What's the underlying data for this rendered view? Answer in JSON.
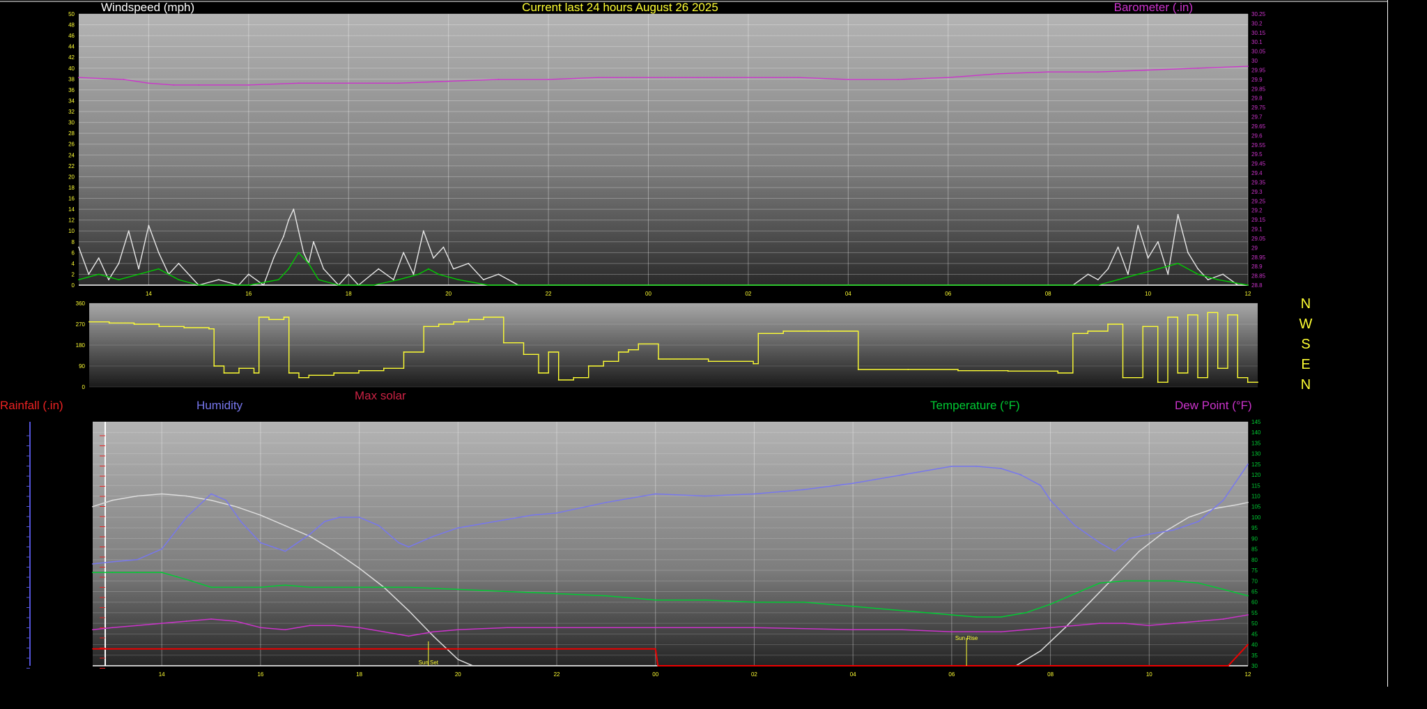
{
  "header": {
    "windspeed_title": "Windspeed (mph)",
    "main_title": "Current last 24 hours August 26 2025",
    "barometer_title": "Barometer (.in)"
  },
  "compass": {
    "labels": [
      "N",
      "W",
      "S",
      "E",
      "N"
    ]
  },
  "bottom_legend": {
    "rainfall": "Rainfall (.in)",
    "humidity": "Humidity",
    "max_solar": "Max solar",
    "temperature": "Temperature (°F)",
    "dew_point": "Dew Point (°F)"
  },
  "annotations": {
    "sunset": "Sun Set",
    "sunrise": "Sun Rise"
  },
  "colors": {
    "wind": "#e8e8e8",
    "gust": "#00cc00",
    "barometer": "#cc33cc",
    "direction": "#ffff33",
    "humidity": "#7777ee",
    "temperature": "#00cc33",
    "dewpoint": "#cc33cc",
    "rain": "#ee0000",
    "solar": "#dddddd",
    "title": "#ffff33",
    "rain_label": "#ee2222",
    "solar_label": "#cc2244"
  },
  "chart_data": [
    {
      "type": "line",
      "name": "windspeed-barometer",
      "x_ticks": [
        "14",
        "16",
        "18",
        "20",
        "22",
        "00",
        "02",
        "04",
        "06",
        "08",
        "10",
        "12"
      ],
      "x_hours": [
        14,
        16,
        18,
        20,
        22,
        24,
        26,
        28,
        30,
        32,
        34,
        36
      ],
      "xlim": [
        12.6,
        36
      ],
      "ylabel_left": "Windspeed (mph)",
      "ylim_left": [
        0,
        50
      ],
      "yticks_left": [
        "0",
        "2",
        "4",
        "6",
        "8",
        "10",
        "12",
        "14",
        "16",
        "18",
        "20",
        "22",
        "24",
        "26",
        "28",
        "30",
        "32",
        "34",
        "36",
        "38",
        "40",
        "42",
        "44",
        "46",
        "48",
        "50"
      ],
      "ylabel_right": "Barometer (.in)",
      "ylim_right": [
        28.8,
        30.25
      ],
      "yticks_right": [
        "28.8",
        "28.85",
        "28.9",
        "28.95",
        "29",
        "29.05",
        "29.1",
        "29.15",
        "29.2",
        "29.25",
        "29.3",
        "29.35",
        "29.4",
        "29.45",
        "29.5",
        "29.55",
        "29.6",
        "29.65",
        "29.7",
        "29.75",
        "29.8",
        "29.85",
        "29.9",
        "29.95",
        "30",
        "30.05",
        "30.1",
        "30.15",
        "30.2",
        "30.25"
      ],
      "series": [
        {
          "key": "wind",
          "x": [
            12.6,
            12.8,
            13.0,
            13.2,
            13.4,
            13.6,
            13.8,
            14.0,
            14.2,
            14.4,
            14.6,
            15.0,
            15.4,
            15.8,
            16.0,
            16.3,
            16.5,
            16.7,
            16.8,
            16.9,
            17.0,
            17.1,
            17.2,
            17.3,
            17.5,
            17.8,
            18.0,
            18.2,
            18.6,
            18.9,
            19.1,
            19.3,
            19.5,
            19.7,
            19.9,
            20.1,
            20.4,
            20.7,
            21.0,
            21.4,
            22.0,
            24.0,
            28.0,
            32.0,
            32.5,
            32.8,
            33.0,
            33.2,
            33.4,
            33.6,
            33.8,
            34.0,
            34.2,
            34.4,
            34.6,
            34.8,
            35.0,
            35.2,
            35.5,
            35.8,
            36.0
          ],
          "y": [
            7,
            2,
            5,
            1,
            4,
            10,
            3,
            11,
            6,
            2,
            4,
            0,
            1,
            0,
            2,
            0,
            5,
            9,
            12,
            14,
            10,
            6,
            4,
            8,
            3,
            0,
            2,
            0,
            3,
            1,
            6,
            2,
            10,
            5,
            7,
            3,
            4,
            1,
            2,
            0,
            0,
            0,
            0,
            0,
            0,
            2,
            1,
            3,
            7,
            2,
            11,
            5,
            8,
            2,
            13,
            6,
            3,
            1,
            2,
            0,
            0
          ]
        },
        {
          "key": "gust",
          "x": [
            12.6,
            13.0,
            13.4,
            13.8,
            14.2,
            14.6,
            15.0,
            16.0,
            16.6,
            16.8,
            17.0,
            17.2,
            17.4,
            17.8,
            18.5,
            19.0,
            19.4,
            19.6,
            19.8,
            20.2,
            20.8,
            22.0,
            28.0,
            33.0,
            33.4,
            33.8,
            34.2,
            34.6,
            35.0,
            35.4,
            36.0
          ],
          "y": [
            1,
            2,
            1,
            2,
            3,
            1,
            0,
            0,
            1,
            3,
            6,
            4,
            1,
            0,
            0,
            1,
            2,
            3,
            2,
            1,
            0,
            0,
            0,
            0,
            1,
            2,
            3,
            4,
            2,
            1,
            0
          ]
        },
        {
          "key": "barometer",
          "x": [
            12.6,
            13.5,
            14.0,
            14.5,
            15.0,
            16.0,
            17.0,
            18.0,
            19.0,
            20.0,
            21.0,
            22.0,
            23.0,
            24.0,
            25.0,
            26.0,
            27.0,
            28.0,
            29.0,
            30.0,
            31.0,
            32.0,
            33.0,
            34.0,
            35.0,
            36.0
          ],
          "y": [
            29.91,
            29.9,
            29.88,
            29.87,
            29.87,
            29.87,
            29.88,
            29.88,
            29.88,
            29.89,
            29.9,
            29.9,
            29.91,
            29.91,
            29.91,
            29.91,
            29.91,
            29.9,
            29.9,
            29.91,
            29.93,
            29.94,
            29.94,
            29.95,
            29.96,
            29.97
          ]
        }
      ]
    },
    {
      "type": "line",
      "name": "wind-direction",
      "xlim": [
        12.6,
        36
      ],
      "ylim": [
        0,
        360
      ],
      "yticks": [
        "0",
        "90",
        "180",
        "270",
        "360"
      ],
      "series": [
        {
          "key": "direction",
          "x": [
            12.6,
            13.0,
            13.5,
            14.0,
            14.5,
            15.0,
            15.1,
            15.3,
            15.6,
            15.9,
            16.0,
            16.2,
            16.5,
            16.6,
            16.8,
            17.0,
            17.5,
            18.0,
            18.5,
            18.9,
            19.3,
            19.6,
            19.9,
            20.2,
            20.5,
            20.9,
            21.3,
            21.6,
            21.8,
            22.0,
            22.3,
            22.6,
            22.9,
            23.2,
            23.4,
            23.6,
            24.0,
            25.0,
            25.9,
            26.0,
            26.5,
            27.0,
            27.4,
            28.0,
            29.0,
            30.0,
            31.0,
            32.0,
            32.3,
            32.6,
            33.0,
            33.3,
            33.7,
            34.0,
            34.2,
            34.4,
            34.6,
            34.8,
            35.0,
            35.2,
            35.4,
            35.6,
            35.8,
            36.0
          ],
          "y": [
            280,
            275,
            270,
            260,
            255,
            250,
            90,
            60,
            80,
            60,
            300,
            290,
            300,
            60,
            40,
            50,
            60,
            70,
            80,
            150,
            260,
            270,
            280,
            290,
            300,
            190,
            140,
            60,
            150,
            30,
            40,
            90,
            110,
            150,
            160,
            185,
            120,
            110,
            100,
            230,
            240,
            240,
            240,
            75,
            75,
            70,
            68,
            60,
            230,
            240,
            270,
            40,
            260,
            20,
            300,
            60,
            310,
            40,
            320,
            80,
            310,
            40,
            20,
            20
          ]
        }
      ]
    },
    {
      "type": "line",
      "name": "rain-humidity-temperature",
      "x_ticks": [
        "14",
        "16",
        "18",
        "20",
        "22",
        "00",
        "02",
        "04",
        "06",
        "08",
        "10",
        "12"
      ],
      "x_hours": [
        14,
        16,
        18,
        20,
        22,
        24,
        26,
        28,
        30,
        32,
        34,
        36
      ],
      "xlim": [
        12.6,
        36
      ],
      "ylabel_left": "Rainfall (.in)",
      "ylabel_right": "Temperature (°F)",
      "ylim_right": [
        30,
        145
      ],
      "yticks_right": [
        "30",
        "35",
        "40",
        "45",
        "50",
        "55",
        "60",
        "65",
        "70",
        "75",
        "80",
        "85",
        "90",
        "95",
        "100",
        "105",
        "110",
        "115",
        "120",
        "125",
        "130",
        "135",
        "140",
        "145"
      ],
      "sunset_hour": 19.4,
      "sunrise_hour": 30.3,
      "series": [
        {
          "key": "humidity",
          "x": [
            12.6,
            13.0,
            13.5,
            14.0,
            14.5,
            15.0,
            15.3,
            15.6,
            16.0,
            16.5,
            17.0,
            17.3,
            17.6,
            18.0,
            18.4,
            18.8,
            19.0,
            19.5,
            20.0,
            20.5,
            21.0,
            21.5,
            22.0,
            23.0,
            24.0,
            25.0,
            26.0,
            27.0,
            28.0,
            29.0,
            30.0,
            30.5,
            31.0,
            31.4,
            31.8,
            32.0,
            32.5,
            33.0,
            33.3,
            33.6,
            34.0,
            34.5,
            35.0,
            35.5,
            36.0
          ],
          "y": [
            78,
            79,
            80,
            85,
            100,
            111,
            108,
            98,
            88,
            84,
            92,
            98,
            100,
            100,
            96,
            88,
            86,
            91,
            95,
            97,
            99,
            101,
            102,
            107,
            111,
            110,
            111,
            113,
            116,
            120,
            124,
            124,
            123,
            120,
            115,
            108,
            96,
            88,
            84,
            90,
            92,
            94,
            98,
            108,
            125
          ]
        },
        {
          "key": "temperature",
          "x": [
            12.6,
            13.0,
            13.5,
            14.0,
            14.3,
            14.6,
            15.0,
            16.0,
            16.5,
            17.0,
            18.0,
            19.0,
            20.0,
            21.0,
            22.0,
            23.0,
            24.0,
            25.0,
            26.0,
            27.0,
            28.0,
            29.0,
            30.0,
            30.5,
            31.0,
            31.5,
            32.0,
            32.5,
            33.0,
            33.5,
            34.0,
            34.5,
            35.0,
            35.5,
            36.0
          ],
          "y": [
            74,
            74,
            74,
            74,
            72,
            70,
            67,
            67,
            68,
            67,
            67,
            67,
            66,
            65,
            64,
            63,
            61,
            61,
            60,
            60,
            58,
            56,
            54,
            53,
            53,
            55,
            59,
            64,
            69,
            70,
            70,
            70,
            69,
            66,
            63
          ]
        },
        {
          "key": "dewpoint",
          "x": [
            12.6,
            13.0,
            13.5,
            14.0,
            14.5,
            15.0,
            15.5,
            16.0,
            16.5,
            17.0,
            17.5,
            18.0,
            18.5,
            19.0,
            19.5,
            20.0,
            21.0,
            22.0,
            24.0,
            26.0,
            28.0,
            29.0,
            30.0,
            30.5,
            31.0,
            31.5,
            32.0,
            32.5,
            33.0,
            33.5,
            34.0,
            34.5,
            35.0,
            35.5,
            36.0
          ],
          "y": [
            47,
            48,
            49,
            50,
            51,
            52,
            51,
            48,
            47,
            49,
            49,
            48,
            46,
            44,
            46,
            47,
            48,
            48,
            48,
            48,
            47,
            47,
            46,
            46,
            46,
            47,
            48,
            49,
            50,
            50,
            49,
            50,
            51,
            52,
            54
          ]
        },
        {
          "key": "rain",
          "x": [
            12.6,
            24.0,
            24.05,
            35.6,
            35.8,
            36.0
          ],
          "y": [
            38,
            38,
            30,
            30,
            35,
            40
          ]
        },
        {
          "key": "solar",
          "x": [
            12.6,
            13.0,
            13.5,
            14.0,
            14.5,
            15.0,
            15.5,
            16.0,
            16.5,
            17.0,
            17.5,
            18.0,
            18.5,
            19.0,
            19.5,
            20.0,
            20.3,
            31.3,
            31.8,
            32.3,
            32.8,
            33.3,
            33.8,
            34.3,
            34.8,
            35.3,
            35.8,
            36.0
          ],
          "y": [
            105,
            108,
            110,
            111,
            110,
            108,
            105,
            101,
            96,
            91,
            84,
            76,
            67,
            56,
            44,
            33,
            30,
            30,
            37,
            48,
            60,
            72,
            84,
            93,
            100,
            104,
            106,
            107
          ]
        }
      ]
    }
  ]
}
